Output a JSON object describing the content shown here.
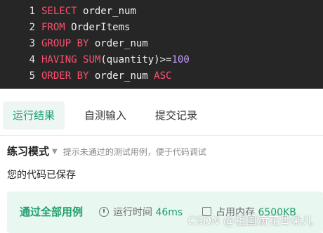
{
  "editor": {
    "lines": [
      {
        "num": "1",
        "tokens": [
          {
            "t": "SELECT",
            "c": "kw"
          },
          {
            "t": " ",
            "c": "id"
          },
          {
            "t": "order_num",
            "c": "id"
          }
        ]
      },
      {
        "num": "2",
        "tokens": [
          {
            "t": "FROM",
            "c": "kw"
          },
          {
            "t": " ",
            "c": "id"
          },
          {
            "t": "OrderItems",
            "c": "id"
          }
        ]
      },
      {
        "num": "3",
        "tokens": [
          {
            "t": "GROUP BY",
            "c": "kw"
          },
          {
            "t": " ",
            "c": "id"
          },
          {
            "t": "order_num",
            "c": "id"
          }
        ]
      },
      {
        "num": "4",
        "tokens": [
          {
            "t": "HAVING",
            "c": "kw"
          },
          {
            "t": " ",
            "c": "id"
          },
          {
            "t": "SUM",
            "c": "fn"
          },
          {
            "t": "(quantity)>=",
            "c": "op"
          },
          {
            "t": "100",
            "c": "num"
          }
        ]
      },
      {
        "num": "5",
        "tokens": [
          {
            "t": "ORDER BY",
            "c": "kw"
          },
          {
            "t": " ",
            "c": "id"
          },
          {
            "t": "order_num",
            "c": "id"
          },
          {
            "t": " ",
            "c": "id"
          },
          {
            "t": "ASC",
            "c": "kw"
          }
        ]
      }
    ]
  },
  "tabs": {
    "run_result": "运行结果",
    "self_test": "自测输入",
    "submit_record": "提交记录"
  },
  "mode": {
    "title": "练习模式",
    "hint": "提示未通过的测试用例，便于代码调试"
  },
  "status": {
    "saved": "您的代码已保存"
  },
  "result": {
    "passed": "通过全部用例",
    "time_label": "运行时间",
    "time_value": "46ms",
    "mem_label": "占用内存",
    "mem_value": "6500KB"
  },
  "watermark": "CSDN @祖国滴花骨朵儿",
  "colors": {
    "editor_bg": "#262626",
    "keyword": "#ff4f6e",
    "number": "#c69cff",
    "accent_green": "#1e9f6c",
    "result_bg": "#e9f7f1"
  }
}
